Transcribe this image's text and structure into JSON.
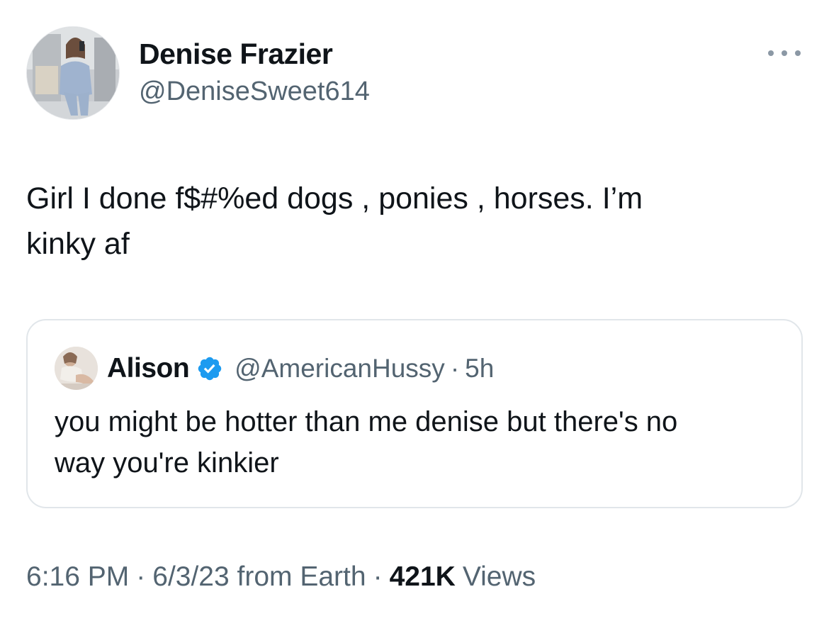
{
  "author": {
    "name": "Denise Frazier",
    "handle": "@DeniseSweet614",
    "avatar_icon": "profile-photo"
  },
  "more_icon": "ellipsis-icon",
  "tweet": {
    "text": "Girl I done f$#%ed dogs , ponies , horses. I’m\nkinky af"
  },
  "quoted": {
    "name": "Alison",
    "verified_icon": "verified-badge-icon",
    "verified_color": "#1d9bf0",
    "handle": "@AmericanHussy",
    "dot": "·",
    "time": "5h",
    "text": "you might be hotter than me denise but there's no\nway you're kinkier"
  },
  "meta": {
    "time": "6:16 PM",
    "sep1": "·",
    "date_source": "6/3/23 from Earth",
    "sep2": "·",
    "views_count": "421K",
    "views_label": "Views"
  }
}
